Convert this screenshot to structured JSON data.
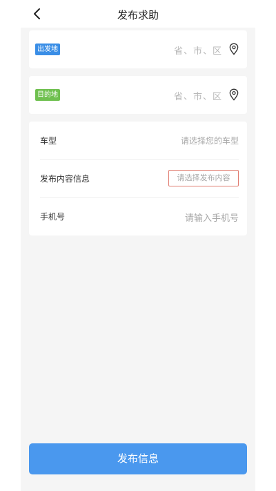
{
  "header": {
    "title": "发布求助",
    "back_icon": "chevron-left-icon"
  },
  "origin": {
    "tag": "出发地",
    "tag_color": "#3a8ee6",
    "placeholder": "省、市、区",
    "icon": "location-pin-icon"
  },
  "destination": {
    "tag": "目的地",
    "tag_color": "#6fc04f",
    "placeholder": "省、市、区",
    "icon": "location-pin-icon"
  },
  "form": {
    "vehicle_label": "车型",
    "vehicle_placeholder": "请选择您的车型",
    "content_label": "发布内容信息",
    "content_placeholder": "请选择发布内容",
    "phone_label": "手机号",
    "phone_placeholder": "请输入手机号"
  },
  "submit": {
    "label": "发布信息",
    "color": "#4a98ee"
  }
}
